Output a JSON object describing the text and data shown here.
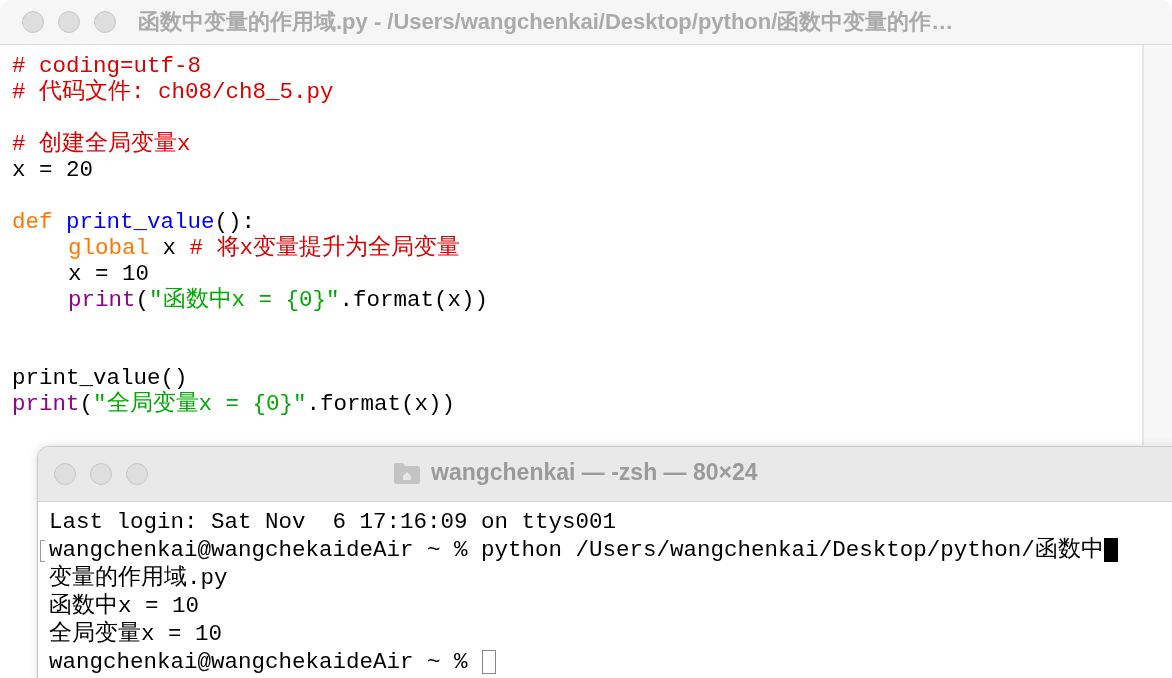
{
  "editor": {
    "title": "函数中变量的作用域.py - /Users/wangchenkai/Desktop/python/函数中变量的作…",
    "lines": [
      {
        "kind": "code",
        "indented": false,
        "tokens": [
          {
            "text": "# coding=utf-8",
            "kind": "comment"
          }
        ]
      },
      {
        "kind": "code",
        "indented": false,
        "tokens": [
          {
            "text": "# 代码文件: ch08/ch8_5.py",
            "kind": "comment"
          }
        ]
      },
      {
        "kind": "blank"
      },
      {
        "kind": "code",
        "indented": false,
        "tokens": [
          {
            "text": "# 创建全局变量x",
            "kind": "comment"
          }
        ]
      },
      {
        "kind": "code",
        "indented": false,
        "tokens": [
          {
            "text": "x = 20",
            "kind": "plain"
          }
        ]
      },
      {
        "kind": "blank"
      },
      {
        "kind": "code",
        "indented": false,
        "tokens": [
          {
            "text": "def ",
            "kind": "keyword"
          },
          {
            "text": "print_value",
            "kind": "defname"
          },
          {
            "text": "():",
            "kind": "plain"
          }
        ]
      },
      {
        "kind": "code",
        "indented": true,
        "tokens": [
          {
            "text": "global",
            "kind": "keyword"
          },
          {
            "text": " x ",
            "kind": "plain"
          },
          {
            "text": "# 将x变量提升为全局变量",
            "kind": "comment"
          }
        ]
      },
      {
        "kind": "code",
        "indented": true,
        "tokens": [
          {
            "text": "x = 10",
            "kind": "plain"
          }
        ]
      },
      {
        "kind": "code",
        "indented": true,
        "tokens": [
          {
            "text": "print",
            "kind": "builtin"
          },
          {
            "text": "(",
            "kind": "plain"
          },
          {
            "text": "\"函数中x = {0}\"",
            "kind": "string"
          },
          {
            "text": ".format(x))",
            "kind": "plain"
          }
        ]
      },
      {
        "kind": "blank"
      },
      {
        "kind": "blank"
      },
      {
        "kind": "code",
        "indented": false,
        "tokens": [
          {
            "text": "print_value()",
            "kind": "plain"
          }
        ]
      },
      {
        "kind": "code",
        "indented": false,
        "tokens": [
          {
            "text": "print",
            "kind": "builtin"
          },
          {
            "text": "(",
            "kind": "plain"
          },
          {
            "text": "\"全局变量x = {0}\"",
            "kind": "string"
          },
          {
            "text": ".format(x))",
            "kind": "plain"
          }
        ]
      }
    ]
  },
  "terminal": {
    "title": "wangchenkai — -zsh — 80×24",
    "lines": [
      {
        "kind": "plain",
        "text": "Last login: Sat Nov  6 17:16:09 on ttys001",
        "marked": false
      },
      {
        "kind": "block_cursor",
        "text": "wangchenkai@wangchekaideAir ~ % python /Users/wangchenkai/Desktop/python/函数中",
        "marked": true
      },
      {
        "kind": "plain",
        "text": "变量的作用域.py",
        "marked": false
      },
      {
        "kind": "plain",
        "text": "函数中x = 10",
        "marked": false
      },
      {
        "kind": "plain",
        "text": "全局变量x = 10",
        "marked": false
      },
      {
        "kind": "hollow_cursor",
        "text": "wangchenkai@wangchekaideAir ~ %",
        "marked": false
      }
    ]
  }
}
